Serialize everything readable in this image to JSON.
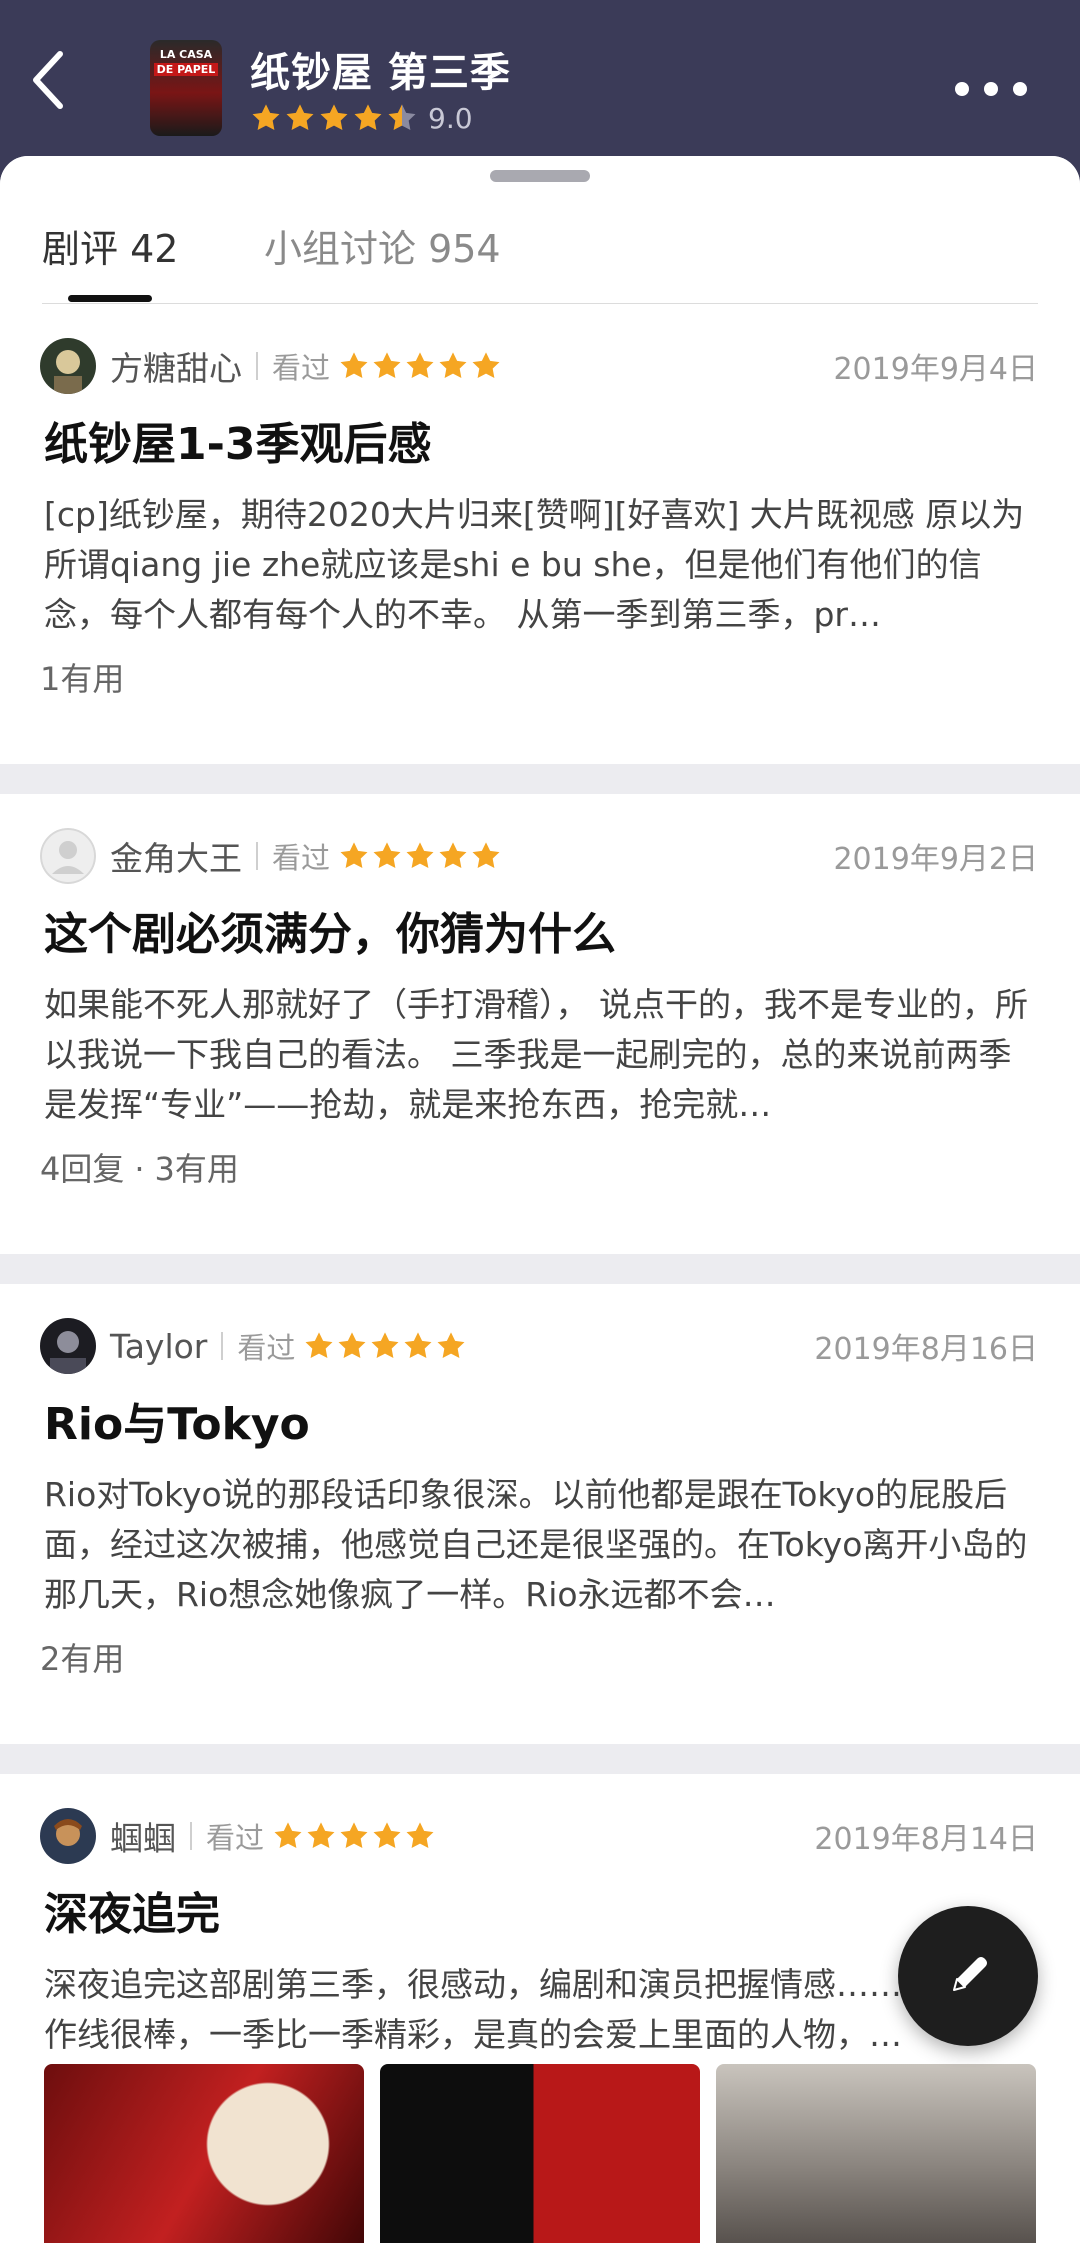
{
  "header": {
    "title": "纸钞屋 第三季",
    "score": "9.0",
    "stars_value": 4.5,
    "poster_text": [
      "LA CASA",
      "DE PAPEL"
    ]
  },
  "tabs": [
    {
      "label": "剧评 42",
      "active": true
    },
    {
      "label": "小组讨论 954",
      "active": false
    }
  ],
  "reviews": [
    {
      "author": "方糖甜心",
      "status": "看过",
      "stars": 5,
      "date": "2019年9月4日",
      "title": "纸钞屋1-3季观后感",
      "excerpt": "[cp]纸钞屋，期待2020大片归来[赞啊][好喜欢] 大片既视感 原以为所谓qiang jie zhe就应该是shi e bu she，但是他们有他们的信念，每个人都有每个人的不幸。 从第一季到第三季，pr…",
      "footer": "1有用"
    },
    {
      "author": "金角大王",
      "status": "看过",
      "stars": 5,
      "date": "2019年9月2日",
      "title": "这个剧必须满分，你猜为什么",
      "excerpt": "如果能不死人那就好了（手打滑稽）， 说点干的，我不是专业的，所以我说一下我自己的看法。 三季我是一起刷完的，总的来说前两季是发挥“专业”——抢劫，就是来抢东西，抢完就…",
      "replies": "4回复",
      "footer": "3有用"
    },
    {
      "author": "Taylor",
      "status": "看过",
      "stars": 5,
      "date": "2019年8月16日",
      "title": "Rio与Tokyo",
      "excerpt": "Rio对Tokyo说的那段话印象很深。以前他都是跟在Tokyo的屁股后面，经过这次被捕，他感觉自己还是很坚强的。在Tokyo离开小岛的那几天，Rio想念她像疯了一样。Rio永远都不会…",
      "footer": "2有用"
    },
    {
      "author": "蝈蝈",
      "status": "看过",
      "stars": 5,
      "date": "2019年8月14日",
      "title": "深夜追完",
      "excerpt": "深夜追完这部剧第三季，很感动，编剧和演员把握情感……作线很棒，一季比一季精彩，是真的会爱上里面的人物，他…"
    }
  ],
  "colors": {
    "header_bg": "#3b3b58",
    "star": "#f5a623",
    "fab_bg": "#1e1e1e"
  },
  "icons": {
    "back": "chevron-left-icon",
    "more": "more-dots-icon",
    "fab": "pencil-icon"
  }
}
